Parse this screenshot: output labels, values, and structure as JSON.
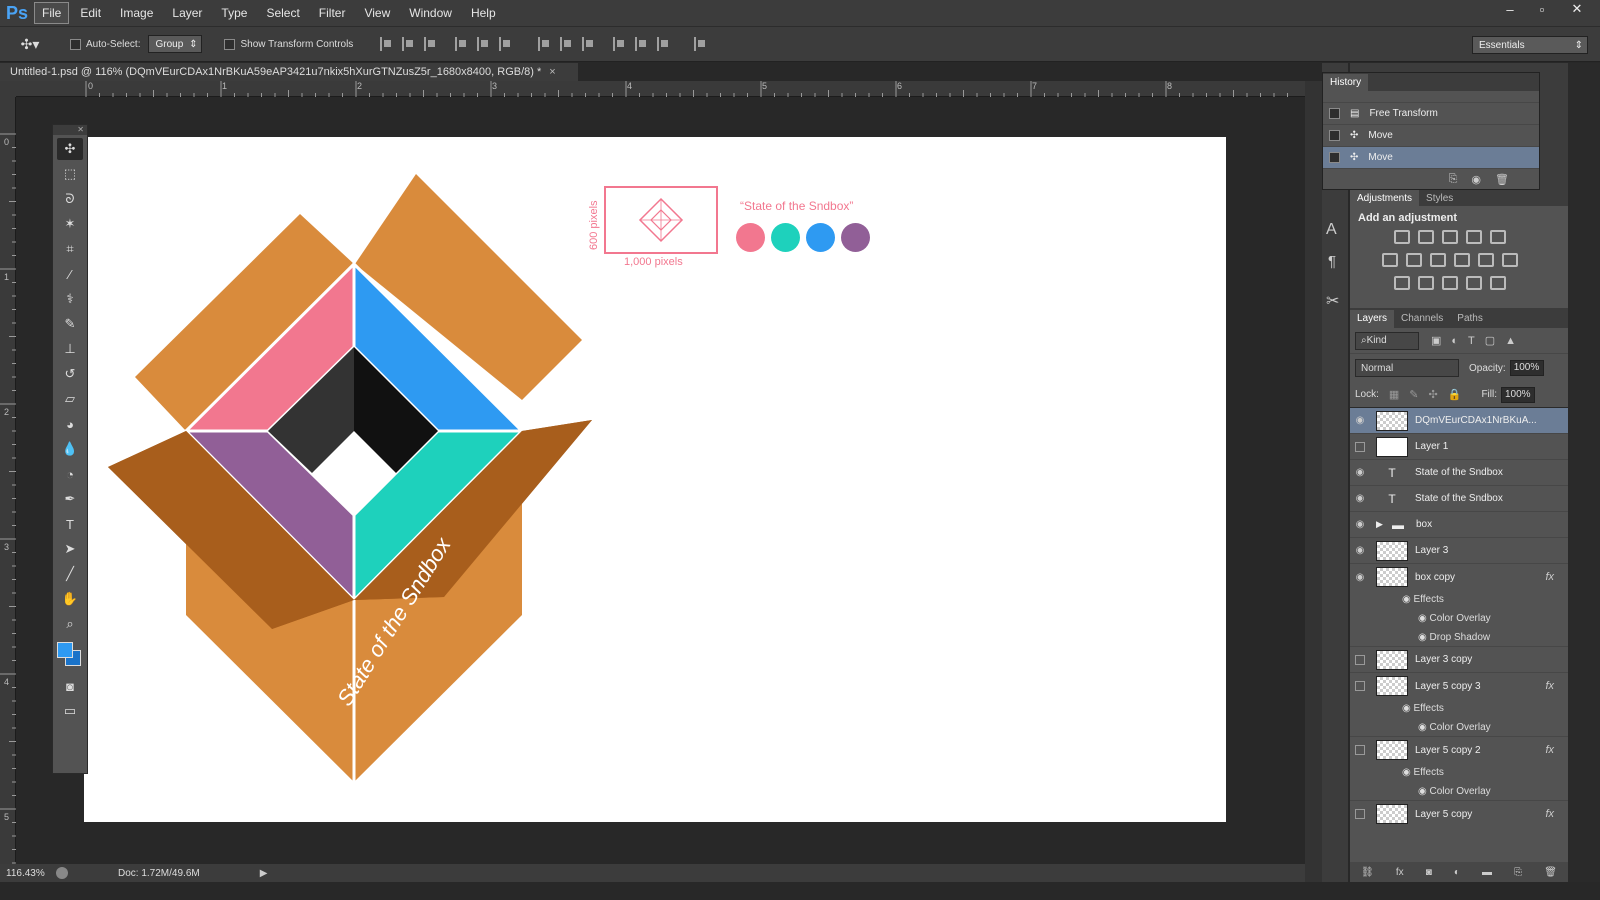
{
  "app": {
    "logo": "Ps"
  },
  "menu": [
    "File",
    "Edit",
    "Image",
    "Layer",
    "Type",
    "Select",
    "Filter",
    "View",
    "Window",
    "Help"
  ],
  "window_controls": {
    "minimize": "–",
    "restore": "▫",
    "close": "✕"
  },
  "options": {
    "auto_select_label": "Auto-Select:",
    "auto_select_value": "Group",
    "transform_label": "Show Transform Controls",
    "workspace": "Essentials"
  },
  "document": {
    "tab_title": "Untitled-1.psd @ 116% (DQmVEurCDAx1NrBKuA59eAP3421u7nkix5hXurGTNZusZ5r_1680x8400, RGB/8) *",
    "tab_close": "×"
  },
  "rulers": {
    "horizontal": [
      "0",
      "1",
      "2",
      "3",
      "4",
      "5",
      "6",
      "7",
      "8"
    ],
    "vertical": [
      "0",
      "1",
      "2",
      "3",
      "4",
      "5"
    ]
  },
  "artwork": {
    "box_text": "State of the Sndbox",
    "quote": "“State of the Sndbox”",
    "height_label": "600 pixels",
    "width_label": "1,000 pixels",
    "swatches": [
      "#f2778f",
      "#1ed1bc",
      "#2e9af2",
      "#915f97"
    ]
  },
  "colors": {
    "box_orange": "#d98b3c",
    "box_dark": "#a85e1c",
    "pink": "#f2778f",
    "blue": "#2e9af2",
    "teal": "#1ed1bc",
    "purple": "#915f97",
    "foreground": "#2e9af2",
    "background": "#1a73c9"
  },
  "status": {
    "zoom": "116.43%",
    "doc": "Doc: 1.72M/49.6M"
  },
  "history": {
    "title": "History",
    "rows": [
      "Free Transform",
      "Move",
      "Move"
    ]
  },
  "adjustments": {
    "tabs": [
      "Adjustments",
      "Styles"
    ],
    "heading": "Add an adjustment"
  },
  "layers": {
    "tabs": [
      "Layers",
      "Channels",
      "Paths"
    ],
    "kind": "Kind",
    "blend_mode": "Normal",
    "opacity_label": "Opacity:",
    "opacity": "100%",
    "lock_label": "Lock:",
    "fill_label": "Fill:",
    "fill": "100%",
    "items": [
      {
        "name": "DQmVEurCDAx1NrBKuA...",
        "type": "smart"
      },
      {
        "name": "Layer 1",
        "type": "image"
      },
      {
        "name": "State of the Sndbox",
        "type": "text"
      },
      {
        "name": "State of the Sndbox",
        "type": "text"
      },
      {
        "name": "box",
        "type": "group"
      },
      {
        "name": "Layer 3",
        "type": "image"
      },
      {
        "name": "box copy",
        "type": "image"
      },
      {
        "name": "Layer 3 copy",
        "type": "image"
      },
      {
        "name": "Layer 5 copy 3",
        "type": "image"
      },
      {
        "name": "Layer 5 copy 2",
        "type": "image"
      },
      {
        "name": "Layer 5 copy",
        "type": "image"
      }
    ],
    "effects_label": "Effects",
    "color_overlay": "Color Overlay",
    "drop_shadow": "Drop Shadow",
    "fx": "fx"
  }
}
